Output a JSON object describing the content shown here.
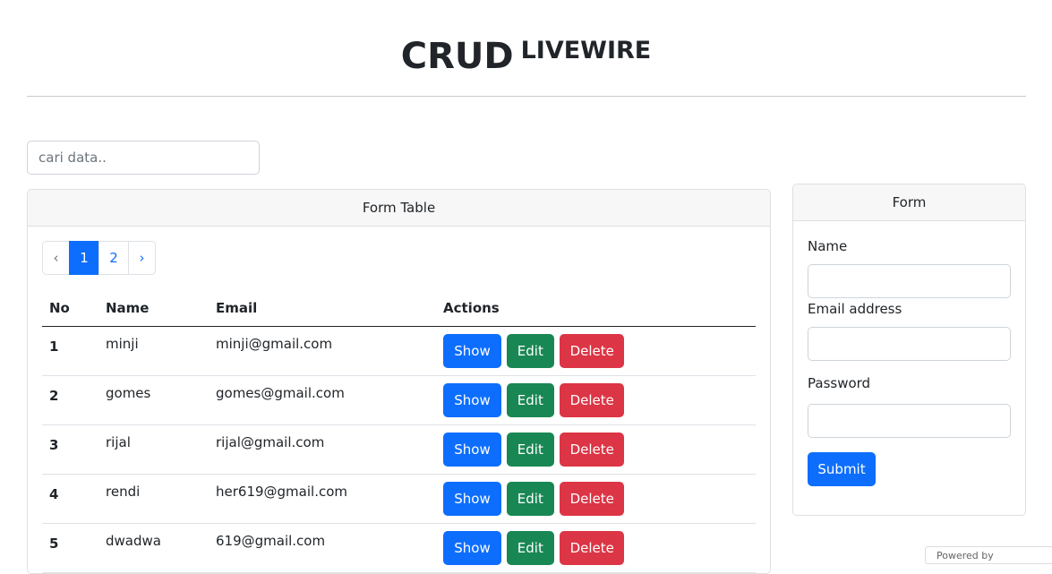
{
  "header": {
    "title_main": "CRUD",
    "title_sup": "LIVEWIRE"
  },
  "search": {
    "placeholder": "cari data..",
    "value": ""
  },
  "table_card": {
    "title": "Form Table",
    "pagination": {
      "prev": "‹",
      "pages": [
        "1",
        "2"
      ],
      "active": "1",
      "next": "›"
    },
    "columns": [
      "No",
      "Name",
      "Email",
      "Actions"
    ],
    "rows": [
      {
        "no": "1",
        "name": "minji",
        "email": "minji@gmail.com"
      },
      {
        "no": "2",
        "name": "gomes",
        "email": "gomes@gmail.com"
      },
      {
        "no": "3",
        "name": "rijal",
        "email": "rijal@gmail.com"
      },
      {
        "no": "4",
        "name": "rendi",
        "email": "her619@gmail.com"
      },
      {
        "no": "5",
        "name": "dwadwa",
        "email": "619@gmail.com"
      }
    ],
    "actions": {
      "show": "Show",
      "edit": "Edit",
      "delete": "Delete"
    }
  },
  "form_card": {
    "title": "Form",
    "name_label": "Name",
    "email_label": "Email address",
    "password_label": "Password",
    "submit_label": "Submit"
  },
  "footer": {
    "powered": "Powered by"
  },
  "colors": {
    "primary": "#0d6efd",
    "success": "#198754",
    "danger": "#dc3545"
  }
}
